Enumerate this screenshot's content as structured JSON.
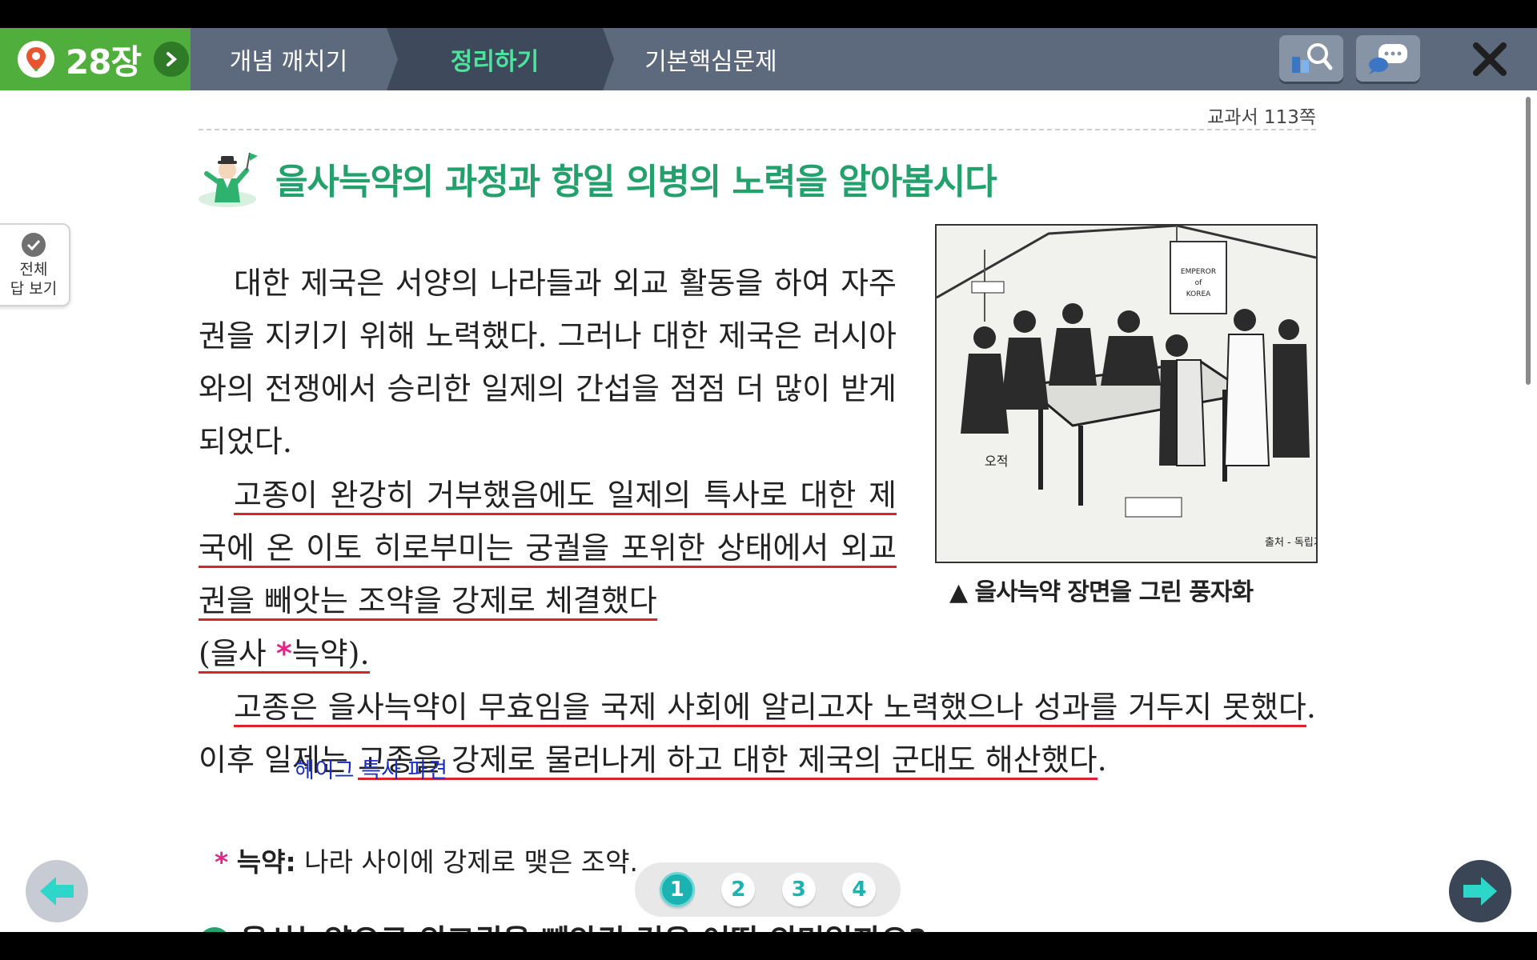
{
  "topbar": {
    "chapter": "28장",
    "tabs": [
      "개념 깨치기",
      "정리하기",
      "기본핵심문제"
    ],
    "active_tab": "정리하기"
  },
  "page_ref": "교과서 113쪽",
  "title": "을사늑약의 과정과 항일 의병의 노력을 알아봅시다",
  "paragraphs": {
    "p1": "대한 제국은 서양의 나라들과 외교 활동을 하여 자주권을 지키기 위해 노력했다. 그러나 대한 제국은 러시아와의 전쟁에서 승리한 일제의 간섭을 점점 더 많이 받게 되었다.",
    "p2_underlined": "고종이 완강히 거부했음에도 일제의 특사로 대한 제국에 온 이토 히로부미는 궁궐을 포위한 상태에서 외교권을 빼앗는 조약을 강제로 체결했다",
    "p2_paren_open": "(을사 ",
    "p2_star": "*",
    "p2_paren_close": "늑약).",
    "p3_underlined_a": "고종은 을사늑약이 무효임을 국제 사회에 알리고자 노력했으나 성과를 거두지 못했다",
    "p3_plain": ". 이후 일제는 ",
    "p3_underlined_b": "고종을 강제로 물러나게 하고 대한 제국의 군대도 해산했다",
    "p3_end": "."
  },
  "annotation": "헤이그 특사 파견",
  "image": {
    "caption": "▲ 을사늑약 장면을 그린 풍자화",
    "inscription_emperor": "EMPEROR of KOREA",
    "source": "출처 - 독립기념관"
  },
  "footnote": {
    "star": "*",
    "term": "늑약:",
    "definition": " 나라 사이에 강제로 맺은 조약."
  },
  "side_button": "전체\n답 보기",
  "side_button_lines": [
    "전체",
    "답 보기"
  ],
  "pager": [
    "1",
    "2",
    "3",
    "4"
  ],
  "active_page": "1",
  "next_section_cut": "을사늑약으로 외교권을 빼앗긴 것은 어떤 의미일까요?",
  "colors": {
    "accent_green": "#23a06b",
    "topbar": "#5d6a7d",
    "chapter_green": "#4fae3c",
    "underline_red": "#d9242f",
    "pager_teal": "#1bb2b2"
  },
  "icons": [
    "map-pin-icon",
    "chevron-right-icon",
    "search-book-icon",
    "chat-icon",
    "close-icon",
    "check-icon",
    "arrow-left-icon",
    "arrow-right-icon"
  ]
}
